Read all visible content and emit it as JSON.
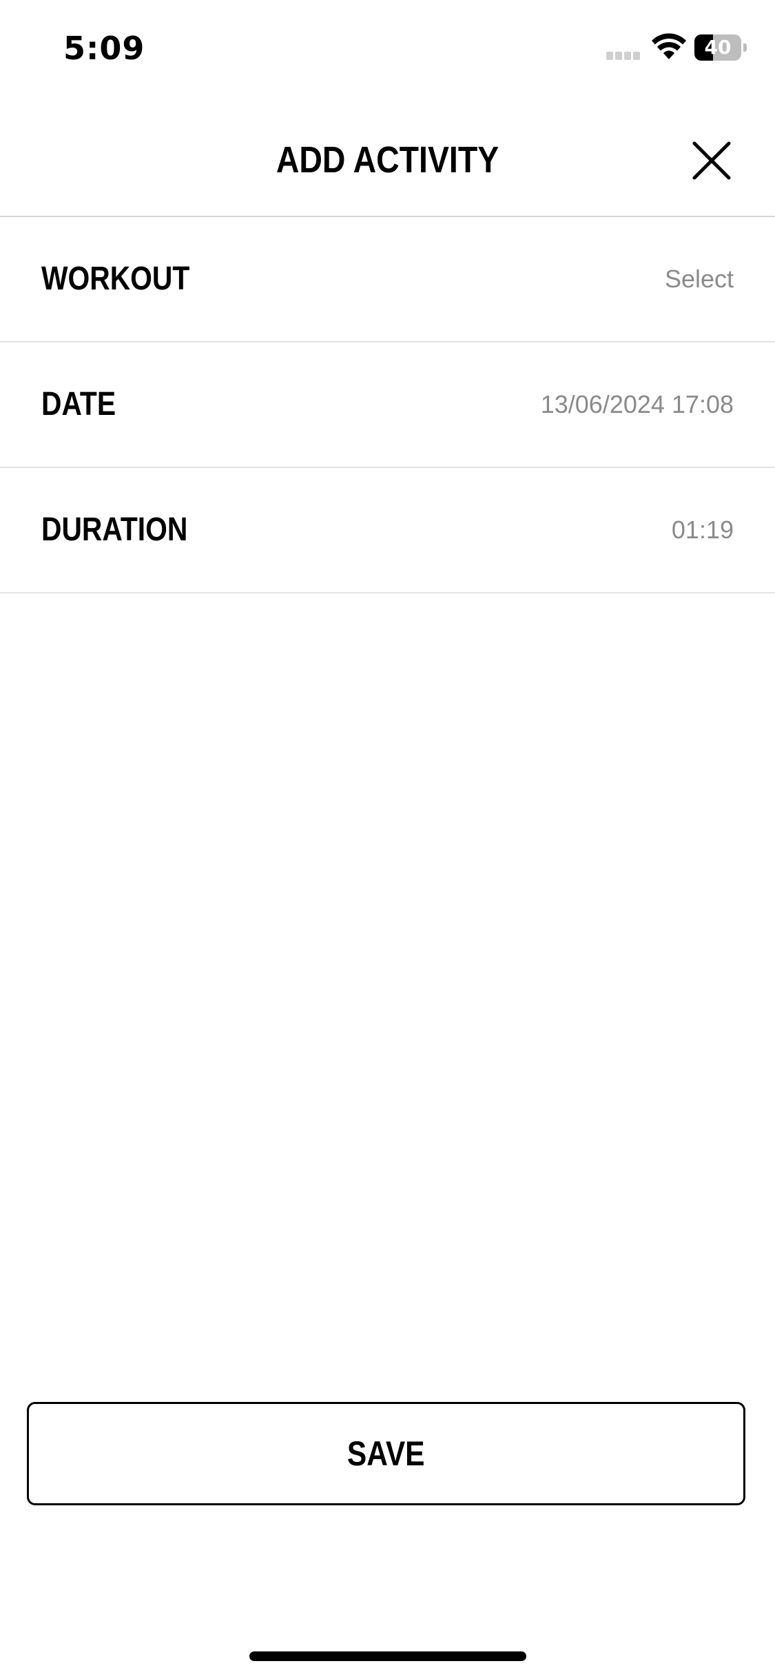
{
  "status_bar": {
    "time": "5:09",
    "battery_level": "40",
    "battery_fraction": 0.4
  },
  "header": {
    "title": "ADD ACTIVITY",
    "close_icon": "close-icon"
  },
  "rows": [
    {
      "label": "WORKOUT",
      "value": "Select"
    },
    {
      "label": "DATE",
      "value": "13/06/2024 17:08"
    },
    {
      "label": "DURATION",
      "value": "01:19"
    }
  ],
  "footer": {
    "save_label": "SAVE"
  },
  "colors": {
    "background": "#ffffff",
    "text": "#000000",
    "value_text": "#8a8a8a",
    "divider": "#e3e3e3"
  }
}
